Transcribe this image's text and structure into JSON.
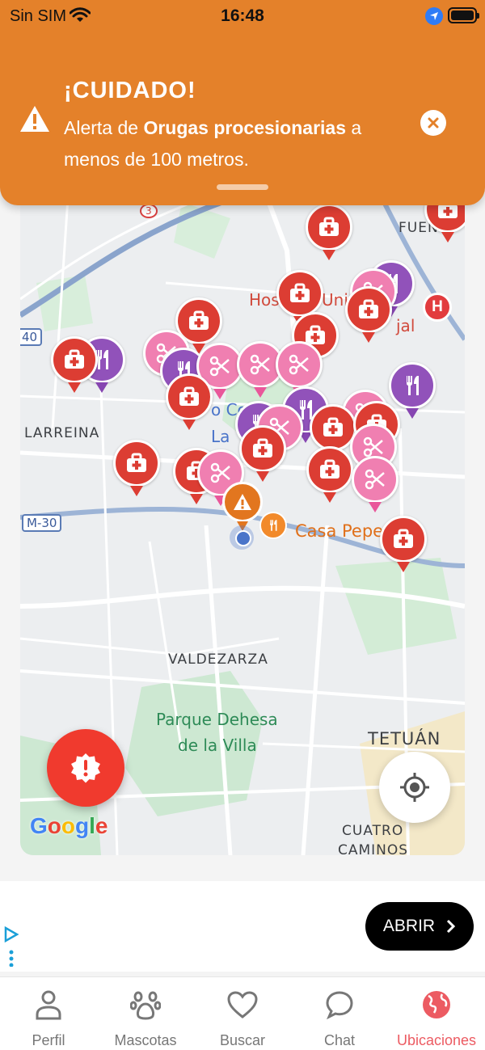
{
  "status_bar": {
    "carrier": "Sin SIM",
    "time": "16:48"
  },
  "notification": {
    "title": "¡CUIDADO!",
    "message_prefix": "Alerta de ",
    "message_bold": "Orugas procesionarias",
    "message_suffix": " a menos de 100 metros.",
    "color": "#e4812a"
  },
  "map": {
    "labels": {
      "larreina": "LARREINA",
      "valdezarza": "VALDEZARZA",
      "parque": "Parque Dehesa",
      "parque2": "de la Villa",
      "tetuan": "TETUÁN",
      "cuatro": "CUATRO",
      "caminos": "CAMINOS",
      "fuen": "FUEN",
      "hosp": "Hos",
      "univ": "Univ",
      "jal": "jal",
      "la": "La",
      "co": "o Co",
      "casa_pepe": "Casa Pepe",
      "m30": "M-30",
      "r40": "40",
      "r3": "3"
    },
    "pin_types": {
      "vet": "#dc3d33",
      "groom": "#f07fb1",
      "food": "#9152ba",
      "warning": "#e2761f"
    },
    "hospital_badge": "H",
    "google": [
      "G",
      "o",
      "o",
      "g",
      "l",
      "e"
    ]
  },
  "ad": {
    "cta": "ABRIR"
  },
  "tabs": [
    {
      "label": "Perfil",
      "icon": "person-icon",
      "active": false
    },
    {
      "label": "Mascotas",
      "icon": "paw-icon",
      "active": false
    },
    {
      "label": "Buscar",
      "icon": "heart-icon",
      "active": false
    },
    {
      "label": "Chat",
      "icon": "chat-bubble-icon",
      "active": false
    },
    {
      "label": "Ubicaciones",
      "icon": "globe-icon",
      "active": true
    }
  ]
}
